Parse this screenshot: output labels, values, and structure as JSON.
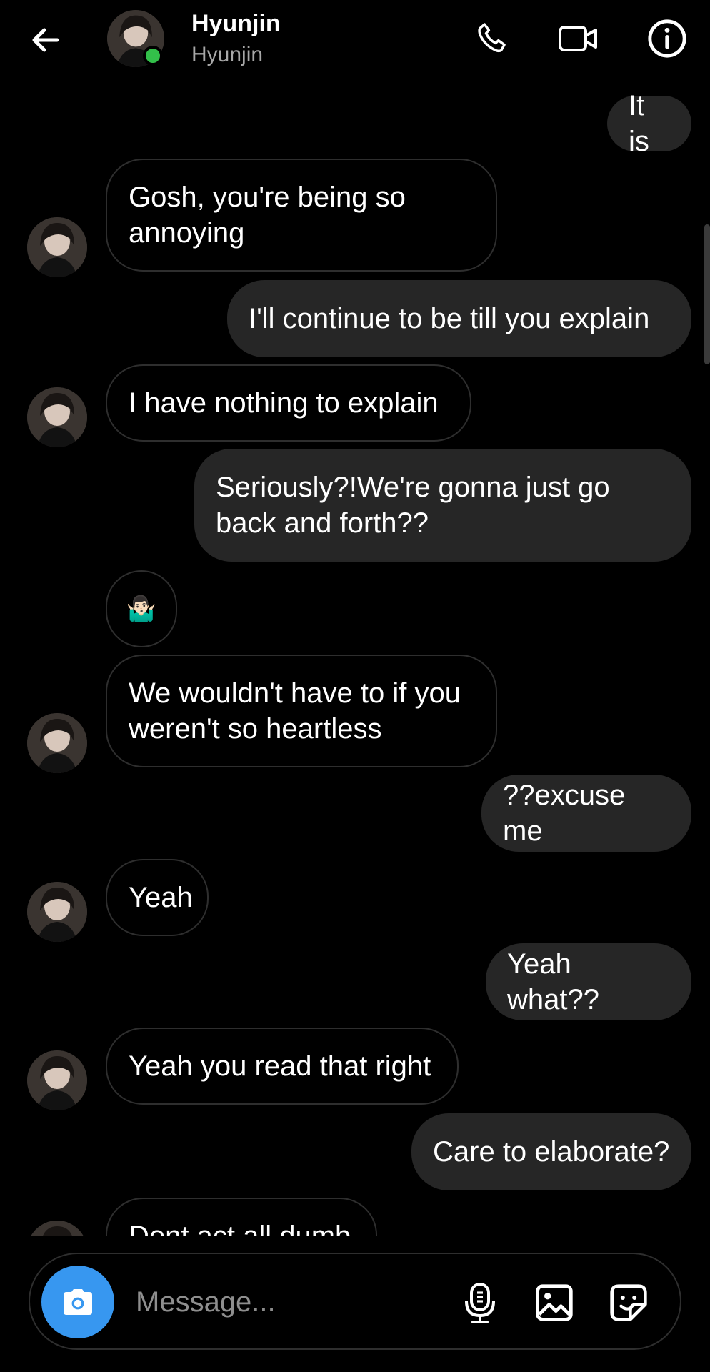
{
  "header": {
    "title": "Hyunjin",
    "subtitle": "Hyunjin"
  },
  "messages": [
    {
      "side": "out",
      "text": "It is"
    },
    {
      "side": "in",
      "text": "Gosh, you're being so\nannoying"
    },
    {
      "side": "out",
      "text": "I'll continue to be till you explain"
    },
    {
      "side": "in",
      "text": "I have nothing to explain"
    },
    {
      "side": "out",
      "text": "Seriously?!We're gonna just go\nback and forth??"
    },
    {
      "side": "in",
      "text": "🤷🏻‍♂️"
    },
    {
      "side": "in",
      "text": "We wouldn't have to if you\nweren't so heartless"
    },
    {
      "side": "out",
      "text": "??excuse me"
    },
    {
      "side": "in",
      "text": "Yeah"
    },
    {
      "side": "out",
      "text": "Yeah what??"
    },
    {
      "side": "in",
      "text": "Yeah you read that right"
    },
    {
      "side": "out",
      "text": "Care to elaborate?"
    },
    {
      "side": "in",
      "text": "Dont act all dumb"
    }
  ],
  "composer": {
    "placeholder": "Message..."
  },
  "icons": {
    "back": "arrow-left",
    "call": "phone",
    "video": "video-camera",
    "info": "info-circle",
    "camera": "camera",
    "mic": "microphone",
    "gallery": "image",
    "sticker": "sticker"
  },
  "colors": {
    "background": "#000000",
    "outgoing_bubble": "#262626",
    "incoming_border": "#2e2e2e",
    "accent": "#3797f0",
    "online": "#33c04a"
  }
}
